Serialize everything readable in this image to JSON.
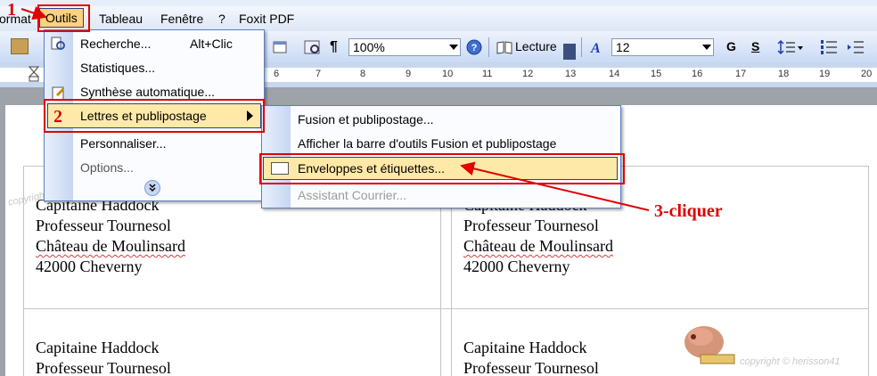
{
  "menubar": {
    "items": [
      "ormat",
      "Outils",
      "Tableau",
      "Fenêtre",
      "?",
      "Foxit PDF"
    ]
  },
  "toolbar": {
    "zoom": "100%",
    "read_label": "Lecture",
    "font_size": "12",
    "bold": "G",
    "strike": "S"
  },
  "ruler": {
    "numbers": [
      "6",
      "7",
      "8",
      "9",
      "10",
      "11",
      "12",
      "13",
      "14",
      "15",
      "16",
      "17",
      "18",
      "19",
      "20"
    ]
  },
  "outils_menu": {
    "items": [
      {
        "label": "Recherche...",
        "shortcut": "Alt+Clic"
      },
      {
        "label": "Statistiques...",
        "shortcut": ""
      },
      {
        "label": "Synthèse automatique...",
        "shortcut": ""
      },
      {
        "label": "Lettres et publipostage",
        "shortcut": ""
      },
      {
        "label": "Personnaliser...",
        "shortcut": ""
      },
      {
        "label": "Options...",
        "shortcut": ""
      }
    ]
  },
  "submenu": {
    "items": [
      {
        "label": "Fusion et publipostage...",
        "enabled": true
      },
      {
        "label": "Afficher la barre d'outils Fusion et publipostage",
        "enabled": true
      },
      {
        "label": "Enveloppes et étiquettes...",
        "enabled": true
      },
      {
        "label": "Assistant Courrier...",
        "enabled": false
      }
    ]
  },
  "labels": {
    "name": "Capitaine Haddock",
    "title": "Professeur Tournesol",
    "place": "Château de Moulinsard",
    "city": "42000 Cheverny"
  },
  "annotations": {
    "step1": "1",
    "step2": "2",
    "step3": "3-cliquer"
  },
  "watermarks": {
    "left": "copyright @ herisson41",
    "right": "copyright © herisson41"
  },
  "colors": {
    "annotation_red": "#e00000",
    "menu_highlight": "#ffe9a8",
    "menu_border": "#26408f"
  }
}
